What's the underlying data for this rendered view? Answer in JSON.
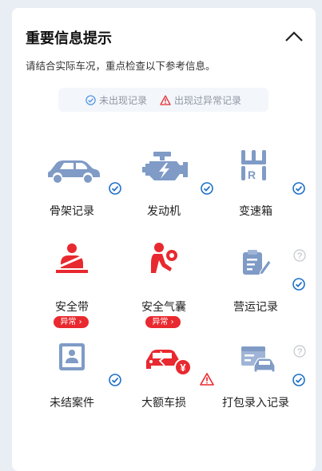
{
  "panel": {
    "title": "重要信息提示",
    "subtitle": "请结合实际车况，重点检查以下参考信息。",
    "collapse_icon": "chevron-up-icon"
  },
  "legend": {
    "normal_label": "未出现记录",
    "abnormal_label": "出现过异常记录",
    "normal_color": "#1e6fc8",
    "abnormal_color": "#e8292f"
  },
  "items": [
    {
      "label": "骨架记录",
      "icon": "car-frame-icon",
      "status": "normal"
    },
    {
      "label": "发动机",
      "icon": "engine-icon",
      "status": "normal"
    },
    {
      "label": "变速箱",
      "icon": "gearbox-icon",
      "status": "normal"
    },
    {
      "label": "安全带",
      "icon": "seatbelt-icon",
      "status": "abnormal",
      "badge": "异常"
    },
    {
      "label": "安全气囊",
      "icon": "airbag-icon",
      "status": "abnormal",
      "badge": "异常"
    },
    {
      "label": "营运记录",
      "icon": "operation-record-icon",
      "status": "normal",
      "help": true
    },
    {
      "label": "未结案件",
      "icon": "pending-case-icon",
      "status": "normal"
    },
    {
      "label": "大额车损",
      "icon": "car-damage-icon",
      "status": "warning"
    },
    {
      "label": "打包录入记录",
      "icon": "package-record-icon",
      "status": "normal",
      "help": true
    }
  ]
}
